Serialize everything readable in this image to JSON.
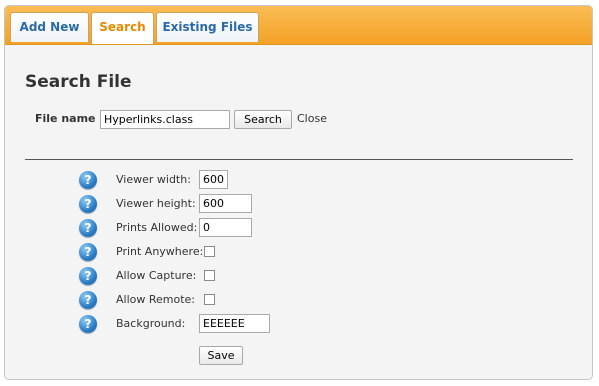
{
  "tabs": [
    {
      "label": "Add New",
      "active": false
    },
    {
      "label": "Search",
      "active": true
    },
    {
      "label": "Existing Files",
      "active": false
    }
  ],
  "panel": {
    "title": "Search File",
    "file_name_label": "File name :",
    "file_name_value": "Hyperlinks.class",
    "search_button": "Search",
    "close_link": "Close"
  },
  "settings": {
    "help_icon": "question-mark-icon",
    "viewer_width": {
      "label": "Viewer width:",
      "value": "600"
    },
    "viewer_height": {
      "label": "Viewer height:",
      "value": "600"
    },
    "prints_allowed": {
      "label": "Prints Allowed:",
      "value": "0"
    },
    "print_anywhere": {
      "label": "Print Anywhere:",
      "checked": false
    },
    "allow_capture": {
      "label": "Allow Capture:",
      "checked": false
    },
    "allow_remote": {
      "label": "Allow Remote:",
      "checked": false
    },
    "background": {
      "label": "Background:",
      "value": "EEEEEE"
    },
    "save_button": "Save"
  },
  "colors": {
    "tabbar_orange": "#f3a125",
    "tab_text_blue": "#2a6aa8",
    "active_tab_text": "#e68a00",
    "help_icon_blue": "#2a7cc7"
  }
}
